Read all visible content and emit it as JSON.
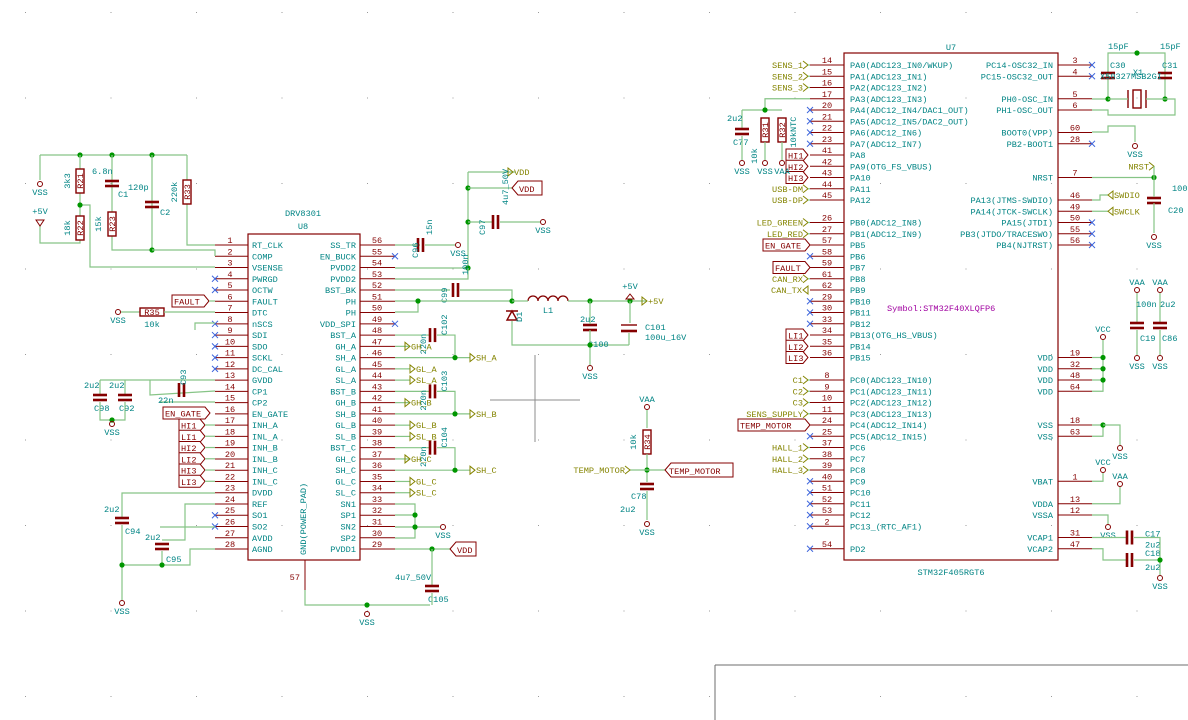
{
  "drv": {
    "ref": "U8",
    "value": "DRV8301",
    "pad": {
      "num": "57",
      "name": "GND(POWER_PAD)"
    },
    "left_pins": [
      {
        "n": "1",
        "name": "RT_CLK"
      },
      {
        "n": "2",
        "name": "COMP"
      },
      {
        "n": "3",
        "name": "VSENSE"
      },
      {
        "n": "4",
        "name": "PWRGD",
        "nc": true
      },
      {
        "n": "5",
        "name": "OCTW",
        "nc": true
      },
      {
        "n": "6",
        "name": "FAULT"
      },
      {
        "n": "7",
        "name": "DTC"
      },
      {
        "n": "8",
        "name": "nSCS",
        "nc": true
      },
      {
        "n": "9",
        "name": "SDI",
        "nc": true
      },
      {
        "n": "10",
        "name": "SDO",
        "nc": true
      },
      {
        "n": "11",
        "name": "SCKL",
        "nc": true
      },
      {
        "n": "12",
        "name": "DC_CAL",
        "nc": true
      },
      {
        "n": "13",
        "name": "GVDD"
      },
      {
        "n": "14",
        "name": "CP1"
      },
      {
        "n": "15",
        "name": "CP2"
      },
      {
        "n": "16",
        "name": "EN_GATE"
      },
      {
        "n": "17",
        "name": "INH_A"
      },
      {
        "n": "18",
        "name": "INL_A"
      },
      {
        "n": "19",
        "name": "INH_B"
      },
      {
        "n": "20",
        "name": "INL_B"
      },
      {
        "n": "21",
        "name": "INH_C"
      },
      {
        "n": "22",
        "name": "INL_C"
      },
      {
        "n": "23",
        "name": "DVDD"
      },
      {
        "n": "24",
        "name": "REF"
      },
      {
        "n": "25",
        "name": "SO1",
        "nc": true
      },
      {
        "n": "26",
        "name": "SO2",
        "nc": true
      },
      {
        "n": "27",
        "name": "AVDD"
      },
      {
        "n": "28",
        "name": "AGND"
      }
    ],
    "right_pins": [
      {
        "n": "56",
        "name": "SS_TR"
      },
      {
        "n": "55",
        "name": "EN_BUCK",
        "nc": true
      },
      {
        "n": "54",
        "name": "PVDD2"
      },
      {
        "n": "53",
        "name": "PVDD2"
      },
      {
        "n": "52",
        "name": "BST_BK"
      },
      {
        "n": "51",
        "name": "PH"
      },
      {
        "n": "50",
        "name": "PH"
      },
      {
        "n": "49",
        "name": "VDD_SPI",
        "nc": true
      },
      {
        "n": "48",
        "name": "BST_A"
      },
      {
        "n": "47",
        "name": "GH_A"
      },
      {
        "n": "46",
        "name": "SH_A"
      },
      {
        "n": "45",
        "name": "GL_A"
      },
      {
        "n": "44",
        "name": "SL_A"
      },
      {
        "n": "43",
        "name": "BST_B"
      },
      {
        "n": "42",
        "name": "GH_B"
      },
      {
        "n": "41",
        "name": "SH_B"
      },
      {
        "n": "40",
        "name": "GL_B"
      },
      {
        "n": "39",
        "name": "SL_B"
      },
      {
        "n": "38",
        "name": "BST_C"
      },
      {
        "n": "37",
        "name": "GH_C"
      },
      {
        "n": "36",
        "name": "SH_C"
      },
      {
        "n": "35",
        "name": "GL_C"
      },
      {
        "n": "34",
        "name": "SL_C"
      },
      {
        "n": "33",
        "name": "SN1"
      },
      {
        "n": "32",
        "name": "SP1"
      },
      {
        "n": "31",
        "name": "SN2"
      },
      {
        "n": "30",
        "name": "SP2"
      },
      {
        "n": "29",
        "name": "PVDD1"
      }
    ]
  },
  "stm": {
    "ref": "U7",
    "value": "STM32F405RGT6",
    "symbol": "Symbol:STM32F40XLQFP6",
    "left_pins": [
      {
        "r": 0,
        "n": "14",
        "name": "PA0(ADC123_IN0/WKUP)"
      },
      {
        "r": 1,
        "n": "15",
        "name": "PA1(ADC123_IN1)"
      },
      {
        "r": 2,
        "n": "16",
        "name": "PA2(ADC123_IN2)"
      },
      {
        "r": 3,
        "n": "17",
        "name": "PA3(ADC123_IN3)"
      },
      {
        "r": 4,
        "n": "20",
        "name": "PA4(ADC12_IN4/DAC1_OUT)",
        "nc": true
      },
      {
        "r": 5,
        "n": "21",
        "name": "PA5(ADC12_IN5/DAC2_OUT)",
        "nc": true
      },
      {
        "r": 6,
        "n": "22",
        "name": "PA6(ADC12_IN6)",
        "nc": true
      },
      {
        "r": 7,
        "n": "23",
        "name": "PA7(ADC12_IN7)",
        "nc": true
      },
      {
        "r": 8,
        "n": "41",
        "name": "PA8"
      },
      {
        "r": 9,
        "n": "42",
        "name": "PA9(OTG_FS_VBUS)"
      },
      {
        "r": 10,
        "n": "43",
        "name": "PA10"
      },
      {
        "r": 11,
        "n": "44",
        "name": "PA11"
      },
      {
        "r": 12,
        "n": "45",
        "name": "PA12"
      },
      {
        "r": 14,
        "n": "26",
        "name": "PB0(ADC12_IN8)"
      },
      {
        "r": 15,
        "n": "27",
        "name": "PB1(ADC12_IN9)"
      },
      {
        "r": 16,
        "n": "57",
        "name": "PB5"
      },
      {
        "r": 17,
        "n": "58",
        "name": "PB6",
        "nc": true
      },
      {
        "r": 18,
        "n": "59",
        "name": "PB7"
      },
      {
        "r": 19,
        "n": "61",
        "name": "PB8"
      },
      {
        "r": 20,
        "n": "62",
        "name": "PB9"
      },
      {
        "r": 21,
        "n": "29",
        "name": "PB10",
        "nc": true
      },
      {
        "r": 22,
        "n": "30",
        "name": "PB11",
        "nc": true
      },
      {
        "r": 23,
        "n": "33",
        "name": "PB12",
        "nc": true
      },
      {
        "r": 24,
        "n": "34",
        "name": "PB13(OTG_HS_VBUS)"
      },
      {
        "r": 25,
        "n": "35",
        "name": "PB14"
      },
      {
        "r": 26,
        "n": "36",
        "name": "PB15"
      },
      {
        "r": 28,
        "n": "8",
        "name": "PC0(ADC123_IN10)"
      },
      {
        "r": 29,
        "n": "9",
        "name": "PC1(ADC123_IN11)"
      },
      {
        "r": 30,
        "n": "10",
        "name": "PC2(ADC123_IN12)"
      },
      {
        "r": 31,
        "n": "11",
        "name": "PC3(ADC123_IN13)"
      },
      {
        "r": 32,
        "n": "24",
        "name": "PC4(ADC12_IN14)"
      },
      {
        "r": 33,
        "n": "25",
        "name": "PC5(ADC12_IN15)",
        "nc": true
      },
      {
        "r": 34,
        "n": "37",
        "name": "PC6"
      },
      {
        "r": 35,
        "n": "38",
        "name": "PC7"
      },
      {
        "r": 36,
        "n": "39",
        "name": "PC8"
      },
      {
        "r": 37,
        "n": "40",
        "name": "PC9",
        "nc": true
      },
      {
        "r": 38,
        "n": "51",
        "name": "PC10",
        "nc": true
      },
      {
        "r": 39,
        "n": "52",
        "name": "PC11",
        "nc": true
      },
      {
        "r": 40,
        "n": "53",
        "name": "PC12",
        "nc": true
      },
      {
        "r": 41,
        "n": "2",
        "name": "PC13_(RTC_AF1)",
        "nc": true
      },
      {
        "r": 43,
        "n": "54",
        "name": "PD2",
        "nc": true
      }
    ],
    "right_pins": [
      {
        "r": 0,
        "n": "3",
        "name": "PC14-OSC32_IN",
        "nc": true
      },
      {
        "r": 1,
        "n": "4",
        "name": "PC15-OSC32_OUT",
        "nc": true
      },
      {
        "r": 3,
        "n": "5",
        "name": "PH0-OSC_IN"
      },
      {
        "r": 4,
        "n": "6",
        "name": "PH1-OSC_OUT"
      },
      {
        "r": 6,
        "n": "60",
        "name": "BOOT0(VPP)"
      },
      {
        "r": 7,
        "n": "28",
        "name": "PB2-BOOT1",
        "nc": true
      },
      {
        "r": 10,
        "n": "7",
        "name": "NRST"
      },
      {
        "r": 12,
        "n": "46",
        "name": "PA13(JTMS-SWDIO)"
      },
      {
        "r": 13,
        "n": "49",
        "name": "PA14(JTCK-SWCLK)"
      },
      {
        "r": 14,
        "n": "50",
        "name": "PA15(JTDI)",
        "nc": true
      },
      {
        "r": 15,
        "n": "55",
        "name": "PB3(JTDO/TRACESWO)",
        "nc": true
      },
      {
        "r": 16,
        "n": "56",
        "name": "PB4(NJTRST)",
        "nc": true
      },
      {
        "r": 26,
        "n": "19",
        "name": "VDD"
      },
      {
        "r": 27,
        "n": "32",
        "name": "VDD"
      },
      {
        "r": 28,
        "n": "48",
        "name": "VDD"
      },
      {
        "r": 29,
        "n": "64",
        "name": "VDD"
      },
      {
        "r": 32,
        "n": "18",
        "name": "VSS"
      },
      {
        "r": 33,
        "n": "63",
        "name": "VSS"
      },
      {
        "r": 37,
        "n": "1",
        "name": "VBAT"
      },
      {
        "r": 39,
        "n": "13",
        "name": "VDDA"
      },
      {
        "r": 40,
        "n": "12",
        "name": "VSSA"
      },
      {
        "r": 42,
        "n": "31",
        "name": "VCAP1"
      },
      {
        "r": 43,
        "n": "47",
        "name": "VCAP2"
      }
    ]
  },
  "parts": {
    "R21": {
      "ref": "R21",
      "value": "3k3"
    },
    "R22": {
      "ref": "R22",
      "value": "18k"
    },
    "R23": {
      "ref": "R23",
      "value": "15k"
    },
    "R33": {
      "ref": "R33",
      "value": "220k"
    },
    "R35": {
      "ref": "R35",
      "value": "10k"
    },
    "C1": {
      "ref": "C1",
      "value": "6.8n"
    },
    "C2": {
      "ref": "C2",
      "value": "120p"
    },
    "C93": {
      "ref": "C93",
      "value": "22n"
    },
    "C98": {
      "ref": "C98",
      "value": "2u2"
    },
    "C92": {
      "ref": "C92",
      "value": "2u2"
    },
    "C94": {
      "ref": "C94",
      "value": "2u2"
    },
    "C95": {
      "ref": "C95",
      "value": "2u2"
    },
    "C96": {
      "ref": "C96",
      "value": "15n"
    },
    "C97": {
      "ref": "C97",
      "value": "4u7_50V"
    },
    "C99": {
      "ref": "C99",
      "value": "100n"
    },
    "C102": {
      "ref": "C102",
      "value": "220n"
    },
    "C103": {
      "ref": "C103",
      "value": "220n"
    },
    "C104": {
      "ref": "C104",
      "value": "220n"
    },
    "C105": {
      "ref": "C105",
      "value": "4u7_50V"
    },
    "D1": {
      "ref": "D1"
    },
    "L1": {
      "ref": "L1"
    },
    "C100": {
      "ref": "C100",
      "value": "2u2"
    },
    "C101": {
      "ref": "C101",
      "value": "100u_16V"
    },
    "R34": {
      "ref": "R34",
      "value": "10k"
    },
    "C78": {
      "ref": "C78",
      "value": "2u2"
    },
    "C77": {
      "ref": "C77",
      "value": "2u2"
    },
    "R31": {
      "ref": "R31",
      "value": "10k"
    },
    "R32": {
      "ref": "R32",
      "value": "10kNTC"
    },
    "C30": {
      "ref": "C30",
      "value": "15pF"
    },
    "C31": {
      "ref": "C31",
      "value": "15pF"
    },
    "X1": {
      "ref": "X1",
      "value": "X50327MSB2GI"
    },
    "C20": {
      "ref": "C20",
      "value": "100n"
    },
    "C19": {
      "ref": "C19",
      "value": "100n"
    },
    "C86": {
      "ref": "C86",
      "value": "2u2"
    },
    "C17": {
      "ref": "C17",
      "value": "2u2"
    },
    "C18": {
      "ref": "C18",
      "value": "2u2"
    }
  },
  "power": {
    "vss": "VSS",
    "vdd": "VDD",
    "p5v": "+5V",
    "vaa": "VAA",
    "vcc": "VCC"
  },
  "labels": {
    "fault": "FAULT",
    "en_gate": "EN_GATE",
    "hi1": "HI1",
    "li1": "LI1",
    "hi2": "HI2",
    "li2": "LI2",
    "hi3": "HI3",
    "li3": "LI3",
    "gh_a": "GH_A",
    "gl_a": "GL_A",
    "sl_a": "SL_A",
    "sh_a": "SH_A",
    "gh_b": "GH_B",
    "gl_b": "GL_B",
    "sl_b": "SL_B",
    "sh_b": "SH_B",
    "gh_c": "GH_C",
    "gl_c": "GL_C",
    "sl_c": "SL_C",
    "sh_c": "SH_C",
    "vdd": "VDD",
    "p5v": "+5V",
    "temp_motor": "TEMP_MOTOR",
    "sens_1": "SENS_1",
    "sens_2": "SENS_2",
    "sens_3": "SENS_3",
    "usb_dm": "USB-DM",
    "usb_dp": "USB-DP",
    "led_green": "LED_GREEN",
    "led_red": "LED_RED",
    "can_rx": "CAN_RX",
    "can_tx": "CAN_TX",
    "c1": "C1",
    "c2": "C2",
    "c3": "C3",
    "sens_supply": "SENS_SUPPLY",
    "hall_1": "HALL_1",
    "hall_2": "HALL_2",
    "hall_3": "HALL_3",
    "nrst": "NRST",
    "swdio": "SWDIO",
    "swclk": "SWCLK"
  },
  "colors": {
    "wire": "#86c486",
    "pin": "#840000",
    "pin_text": "#008484",
    "label": "#848400",
    "junction": "#009600",
    "nc": "#3c64dc",
    "grid": "#9a9a9a"
  }
}
